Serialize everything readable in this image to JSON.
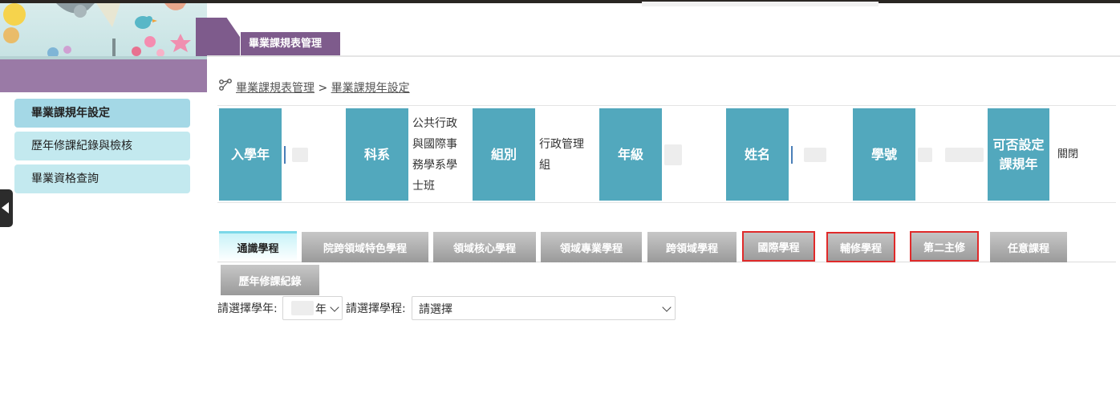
{
  "header": {
    "tab_title": "畢業課規表管理",
    "breadcrumb": [
      "畢業課規表管理",
      "畢業課規年設定"
    ],
    "breadcrumb_sep": ">"
  },
  "sidebar": {
    "items": [
      {
        "label": "畢業課規年設定",
        "active": true
      },
      {
        "label": "歷年修課紀錄與檢核",
        "active": false
      },
      {
        "label": "畢業資格查詢",
        "active": false
      }
    ]
  },
  "student_info": {
    "enroll_year_label": "入學年",
    "department_label": "科系",
    "department_value": "公共行政與國際事務學系學士班",
    "group_label": "組別",
    "group_value": "行政管理組",
    "grade_label": "年級",
    "name_label": "姓名",
    "student_id_label": "學號",
    "can_set_label": "可否設定課規年",
    "can_set_value": "關閉"
  },
  "tabs": [
    {
      "label": "通識學程",
      "active": true,
      "outlined": false
    },
    {
      "label": "院跨領域特色學程",
      "active": false,
      "outlined": false
    },
    {
      "label": "領域核心學程",
      "active": false,
      "outlined": false
    },
    {
      "label": "領域專業學程",
      "active": false,
      "outlined": false
    },
    {
      "label": "跨領域學程",
      "active": false,
      "outlined": false
    },
    {
      "label": "國際學程",
      "active": false,
      "outlined": true
    },
    {
      "label": "輔修學程",
      "active": false,
      "outlined": true
    },
    {
      "label": "第二主修",
      "active": false,
      "outlined": true
    },
    {
      "label": "任意課程",
      "active": false,
      "outlined": false
    },
    {
      "label": "歷年修課紀錄",
      "active": false,
      "outlined": false
    }
  ],
  "filters": {
    "year_label": "請選擇學年:",
    "year_suffix": "年",
    "program_label": "請選擇學程:",
    "program_value": "請選擇"
  },
  "colors": {
    "header_purple": "#7e5b8c",
    "info_teal": "#52a8bd",
    "sidebar_active": "#a4d8e6",
    "outline_red": "#e02a2a"
  },
  "icons": [
    "share-nodes-icon",
    "chevron-down-icon",
    "collapse-triangle-icon"
  ]
}
